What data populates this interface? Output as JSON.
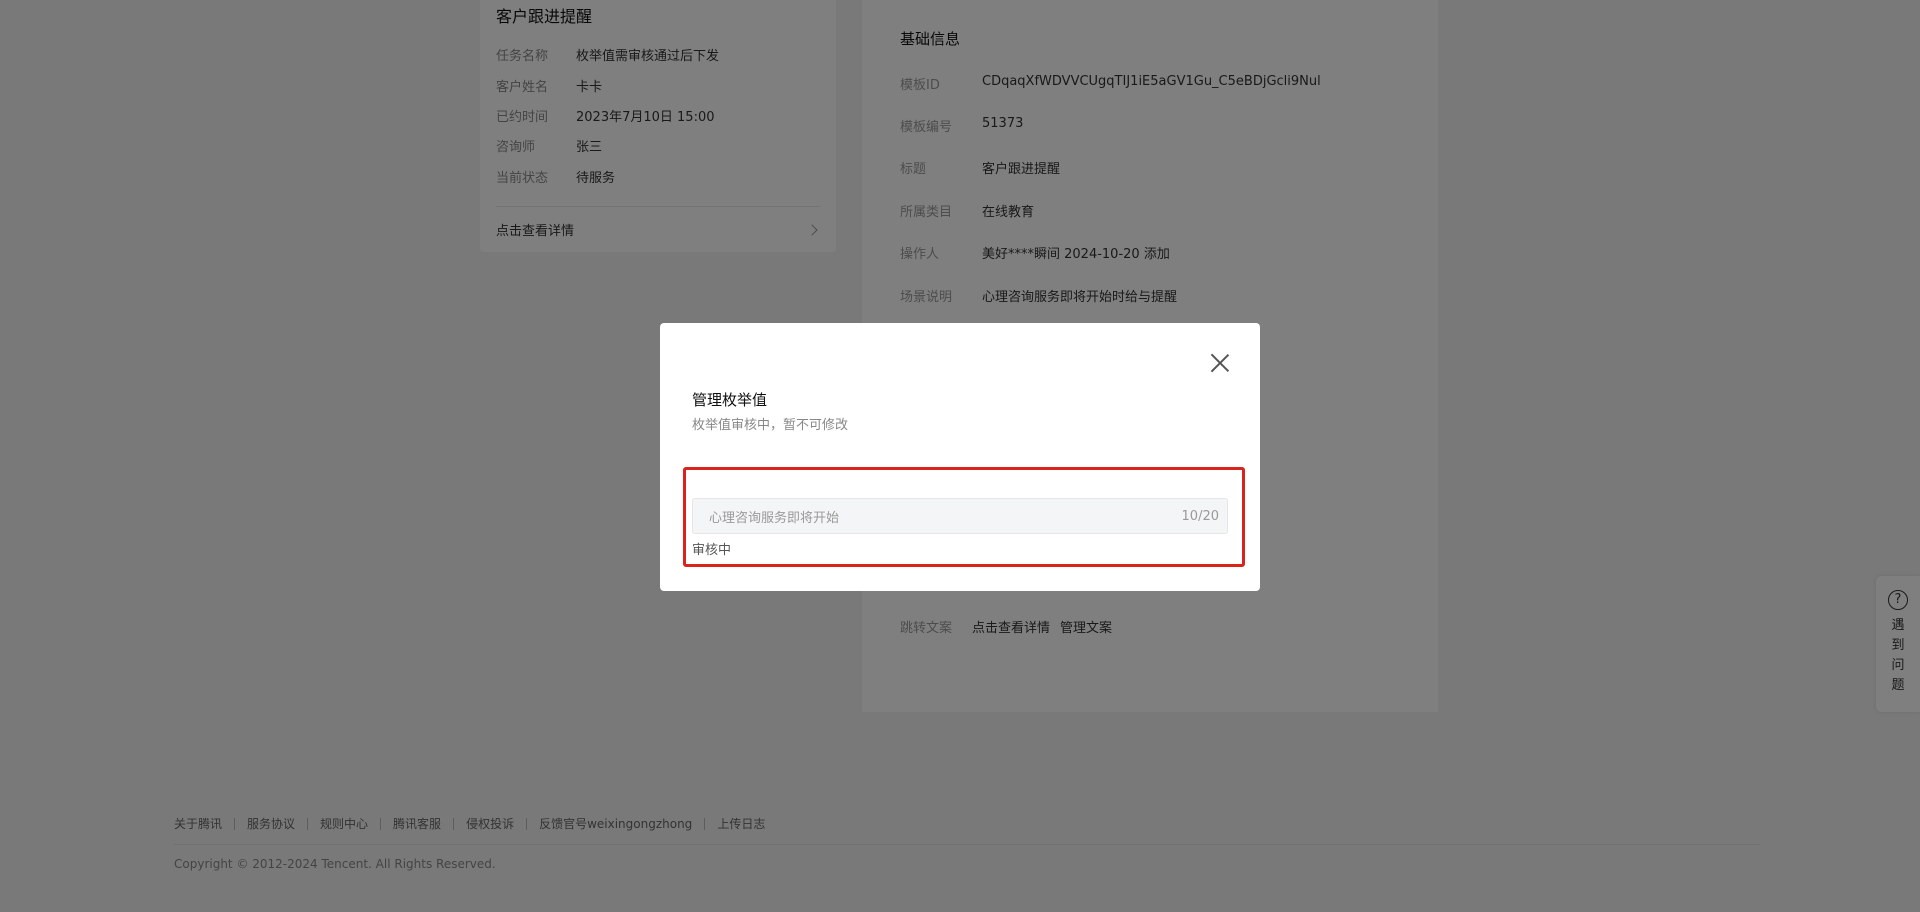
{
  "preview": {
    "title": "客户跟进提醒",
    "rows": [
      {
        "k": "任务名称",
        "v": "枚举值需审核通过后下发"
      },
      {
        "k": "客户姓名",
        "v": "卡卡"
      },
      {
        "k": "已约时间",
        "v": "2023年7月10日 15:00"
      },
      {
        "k": "咨询师",
        "v": "张三"
      },
      {
        "k": "当前状态",
        "v": "待服务"
      }
    ],
    "detail_link": "点击查看详情"
  },
  "info": {
    "title": "基础信息",
    "rows": [
      {
        "k": "模板ID",
        "v": "CDqaqXfWDVVCUgqTIJ1iE5aGV1Gu_C5eBDjGcli9Nul"
      },
      {
        "k": "模板编号",
        "v": "51373"
      },
      {
        "k": "标题",
        "v": "客户跟进提醒"
      },
      {
        "k": "所属类目",
        "v": "在线教育"
      },
      {
        "k": "操作人",
        "v": "美好****瞬间 2024-10-20 添加"
      },
      {
        "k": "场景说明",
        "v": "心理咨询服务即将开始时给与提醒"
      }
    ],
    "jump": {
      "k": "跳转文案",
      "detail": "点击查看详情",
      "manage": "管理文案"
    }
  },
  "footer": {
    "links": [
      "关于腾讯",
      "服务协议",
      "规则中心",
      "腾讯客服",
      "侵权投诉",
      "反馈官号weixingongzhong",
      "上传日志"
    ],
    "copyright": "Copyright © 2012-2024 Tencent. All Rights Reserved."
  },
  "help": {
    "icon": "question-circle-icon",
    "label": "遇到问题"
  },
  "modal": {
    "title": "管理枚举值",
    "description": "枚举值审核中，暂不可修改",
    "input_value": "心理咨询服务即将开始",
    "counter": "10/20",
    "status": "审核中",
    "highlight_color": "#d9231c"
  }
}
